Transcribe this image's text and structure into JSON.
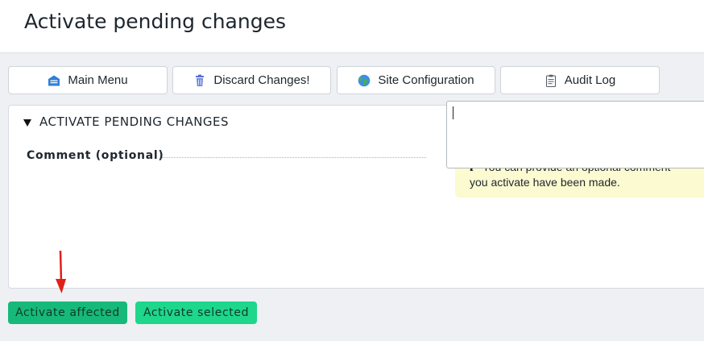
{
  "page": {
    "title": "Activate pending changes"
  },
  "toolbar": {
    "main_menu": "Main Menu",
    "discard": "Discard Changes!",
    "site_config": "Site Configuration",
    "audit_log": "Audit Log"
  },
  "section": {
    "heading": "ACTIVATE PENDING CHANGES",
    "comment_label": "Comment (optional)",
    "help_text": "You can provide an optional comment",
    "help_text_2": "you activate have been made.",
    "comment_value": ""
  },
  "actions": {
    "activate_affected": "Activate affected",
    "activate_selected": "Activate selected"
  },
  "colors": {
    "accent_green": "#16b97a",
    "accent_green_light": "#1ed68c",
    "annotation_arrow": "#e0201a",
    "help_bg": "#fcfad0"
  },
  "icons": [
    "main-menu-icon",
    "trash-icon",
    "globe-icon",
    "clipboard-icon",
    "info-icon"
  ]
}
